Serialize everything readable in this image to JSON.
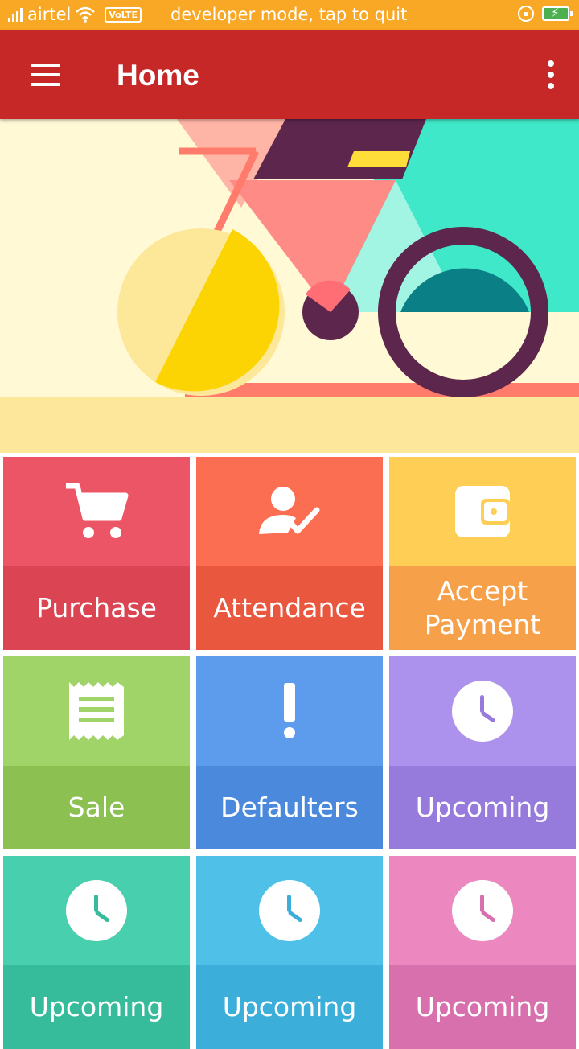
{
  "status_bar": {
    "carrier": "airtel",
    "network_badge": "VoLTE",
    "notice": "developer mode, tap to quit"
  },
  "app_bar": {
    "title": "Home",
    "color": "#C62828"
  },
  "tiles": [
    {
      "label": "Purchase",
      "icon": "cart-icon",
      "top_color": "#EC5565",
      "bottom_color": "#DA4453"
    },
    {
      "label": "Attendance",
      "icon": "user-check-icon",
      "top_color": "#FC6E51",
      "bottom_color": "#E9573F"
    },
    {
      "label": "Accept Payment",
      "icon": "wallet-icon",
      "top_color": "#FFCE54",
      "bottom_color": "#F6A04A"
    },
    {
      "label": "Sale",
      "icon": "receipt-icon",
      "top_color": "#A0D468",
      "bottom_color": "#8CC152"
    },
    {
      "label": "Defaulters",
      "icon": "exclamation-icon",
      "top_color": "#5D9CEC",
      "bottom_color": "#4A89DC"
    },
    {
      "label": "Upcoming",
      "icon": "clock-icon",
      "top_color": "#AC92EC",
      "bottom_color": "#967ADC"
    },
    {
      "label": "Upcoming",
      "icon": "clock-icon",
      "top_color": "#48CFAD",
      "bottom_color": "#37BC9B"
    },
    {
      "label": "Upcoming",
      "icon": "clock-icon",
      "top_color": "#4FC1E9",
      "bottom_color": "#3BAFDA"
    },
    {
      "label": "Upcoming",
      "icon": "clock-icon",
      "top_color": "#EC87C0",
      "bottom_color": "#D770AD"
    }
  ]
}
